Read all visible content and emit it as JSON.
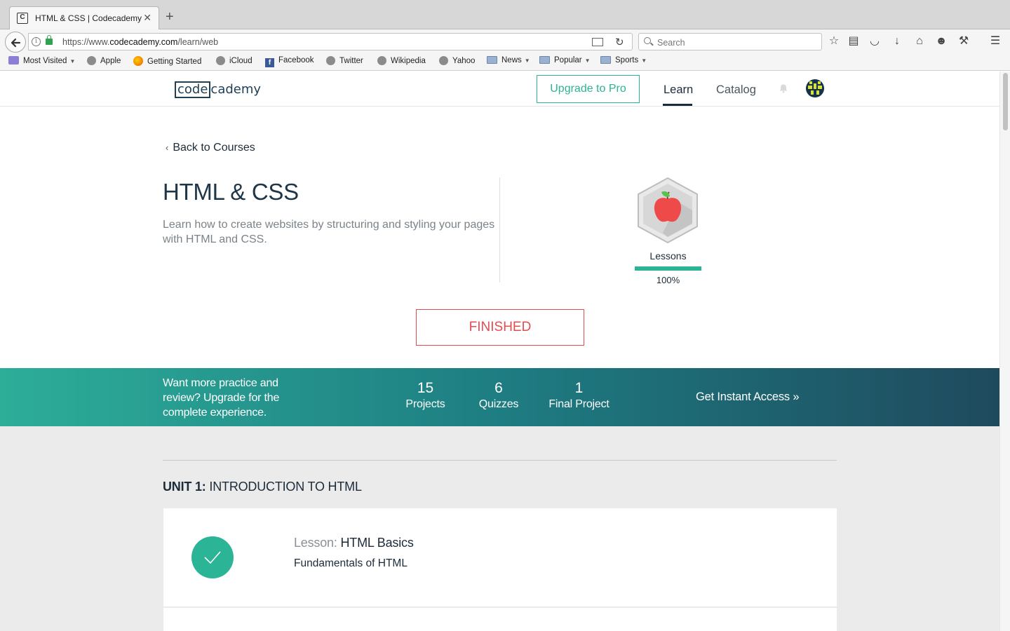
{
  "browser": {
    "tab_title": "HTML & CSS | Codecademy",
    "tab_favicon": "C",
    "url_prefix": "https://www.",
    "url_domain": "codecademy.com",
    "url_path": "/learn/web",
    "search_placeholder": "Search",
    "bookmarks": [
      {
        "label": "Most Visited",
        "icon": "most-visited-icon"
      },
      {
        "label": "Apple",
        "icon": "globe-icon"
      },
      {
        "label": "Getting Started",
        "icon": "firefox-icon"
      },
      {
        "label": "iCloud",
        "icon": "globe-icon"
      },
      {
        "label": "Facebook",
        "icon": "facebook-icon"
      },
      {
        "label": "Twitter",
        "icon": "globe-icon"
      },
      {
        "label": "Wikipedia",
        "icon": "globe-icon"
      },
      {
        "label": "Yahoo",
        "icon": "globe-icon"
      },
      {
        "label": "News",
        "icon": "folder-icon"
      },
      {
        "label": "Popular",
        "icon": "folder-icon"
      },
      {
        "label": "Sports",
        "icon": "folder-icon"
      }
    ]
  },
  "header": {
    "logo_box": "code",
    "logo_rest": "cademy",
    "upgrade_label": "Upgrade to Pro",
    "nav_learn": "Learn",
    "nav_catalog": "Catalog"
  },
  "course": {
    "back_label": "Back to Courses",
    "title": "HTML & CSS",
    "description": "Learn how to create websites by structuring and styling your pages with HTML and CSS.",
    "badge_label": "Lessons",
    "progress_fraction": 1.0,
    "progress_text": "100%",
    "status_label": "FINISHED"
  },
  "promo": {
    "text": "Want more practice and review? Upgrade for the complete experience.",
    "stats": [
      {
        "num": "15",
        "label": "Projects"
      },
      {
        "num": "6",
        "label": "Quizzes"
      },
      {
        "num": "1",
        "label": "Final Project"
      }
    ],
    "cta": "Get Instant Access »"
  },
  "unit": {
    "prefix": "UNIT 1:",
    "title": "INTRODUCTION TO HTML",
    "lesson_prefix": "Lesson:",
    "lesson_name": "HTML Basics",
    "lesson_sub": "Fundamentals of HTML"
  },
  "colors": {
    "accent": "#2bb495",
    "danger": "#e44d50",
    "navy": "#1c2b39"
  }
}
